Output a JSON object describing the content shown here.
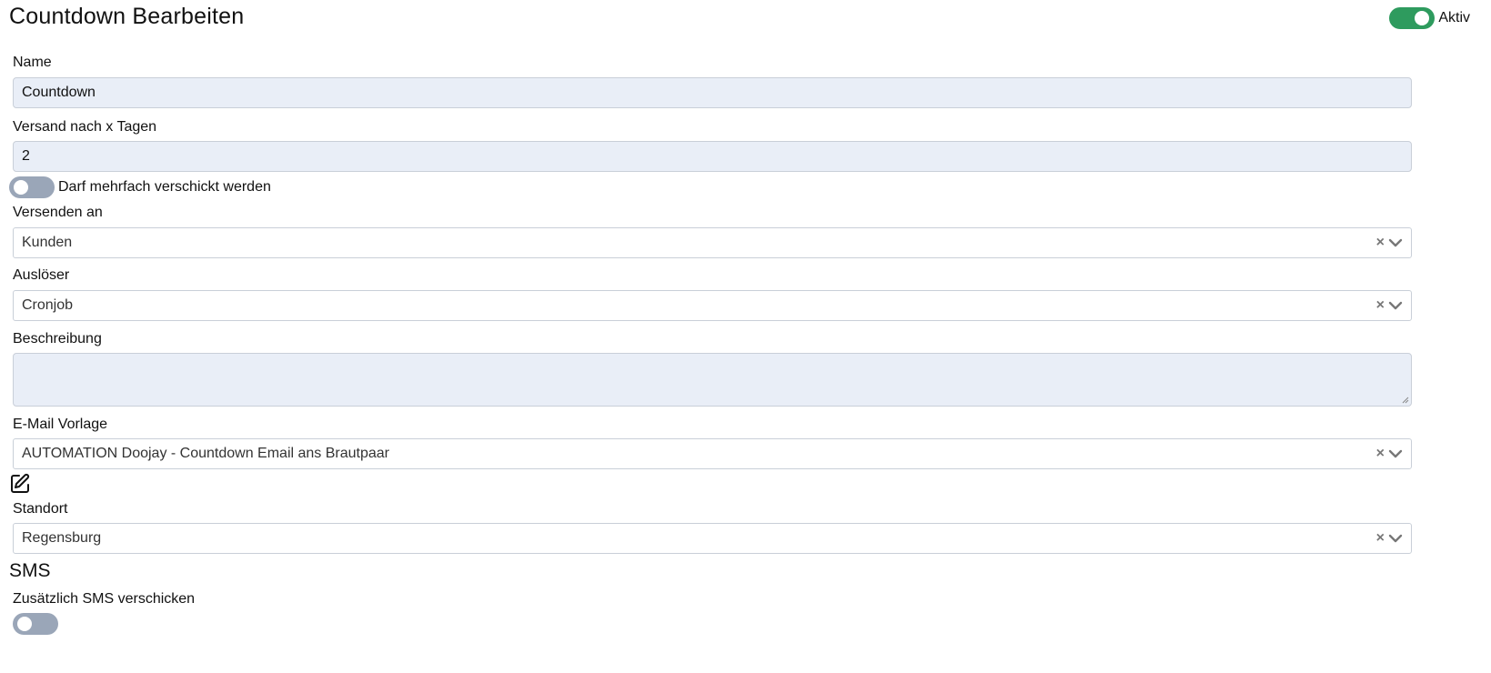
{
  "header": {
    "title": "Countdown Bearbeiten",
    "active_label": "Aktiv",
    "active_on": true
  },
  "form": {
    "name": {
      "label": "Name",
      "value": "Countdown"
    },
    "days": {
      "label": "Versand nach x Tagen",
      "value": "2"
    },
    "multiple": {
      "label": "Darf mehrfach verschickt werden",
      "on": false
    },
    "recipient": {
      "label": "Versenden an",
      "value": "Kunden"
    },
    "trigger": {
      "label": "Auslöser",
      "value": "Cronjob"
    },
    "description": {
      "label": "Beschreibung",
      "value": ""
    },
    "email_template": {
      "label": "E-Mail Vorlage",
      "value": "AUTOMATION Doojay - Countdown Email ans Brautpaar",
      "edit_icon": "edit-icon"
    },
    "location": {
      "label": "Standort",
      "value": "Regensburg"
    }
  },
  "sms": {
    "title": "SMS",
    "extra_label": "Zusätzlich SMS verschicken",
    "on": false
  },
  "icons": {
    "clear": "×",
    "chevron": "chevron-down-icon"
  },
  "colors": {
    "toggle_on": "#2e9b5e",
    "toggle_off": "#9aa6b8",
    "input_bg": "#e9eef7",
    "border": "#c9cfd8"
  }
}
